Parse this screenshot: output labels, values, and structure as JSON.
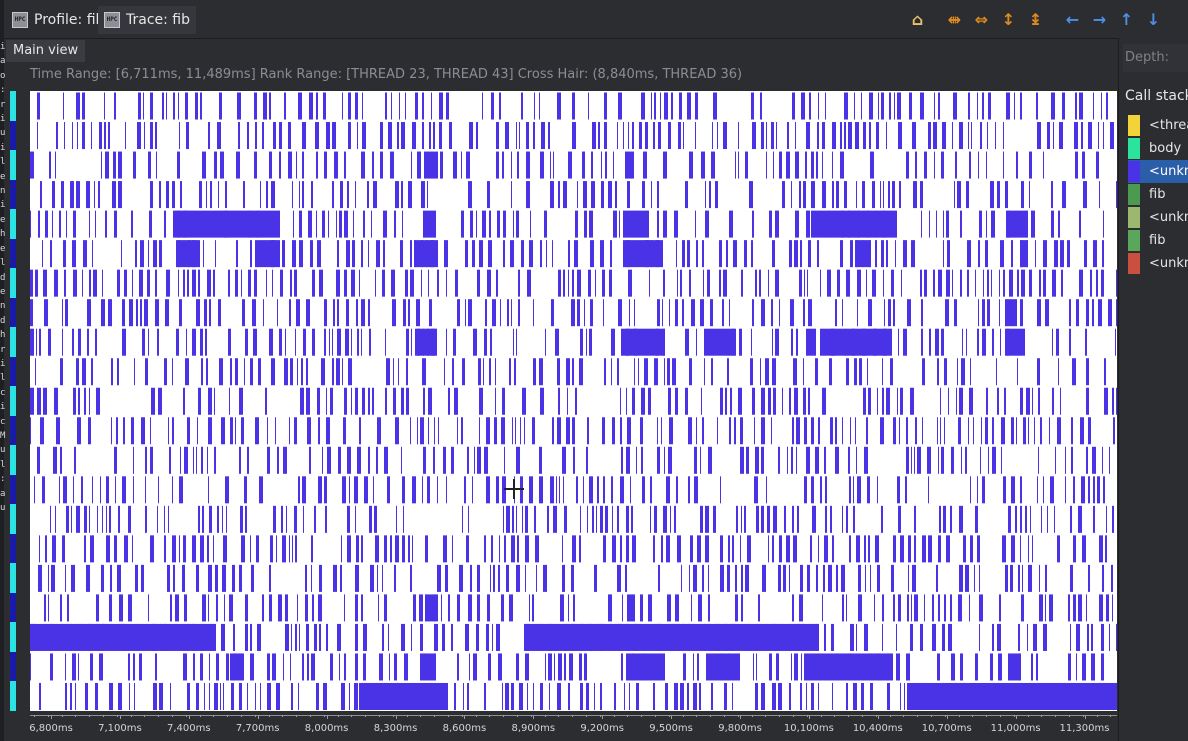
{
  "tabs": [
    {
      "label": "Profile: fib",
      "icon": "hpc-icon"
    },
    {
      "label": "Trace: fib",
      "icon": "hpc-icon"
    }
  ],
  "toolbar": [
    {
      "name": "home-button",
      "icon": "home-icon",
      "glyph": "⌂",
      "color": "#e8c26a"
    },
    {
      "name": "zoom-out-time-button",
      "icon": "zoom-out-time-icon",
      "glyph": "⇼",
      "color": "#e08a1e"
    },
    {
      "name": "zoom-in-time-button",
      "icon": "zoom-in-time-icon",
      "glyph": "⇔",
      "color": "#e08a1e"
    },
    {
      "name": "zoom-in-process-button",
      "icon": "zoom-in-process-icon",
      "glyph": "↕",
      "color": "#e08a1e"
    },
    {
      "name": "zoom-out-process-button",
      "icon": "zoom-out-process-icon",
      "glyph": "↨",
      "color": "#e08a1e"
    },
    {
      "name": "scroll-left-button",
      "icon": "arrow-left-icon",
      "glyph": "←",
      "color": "#4f8fe6"
    },
    {
      "name": "scroll-right-button",
      "icon": "arrow-right-icon",
      "glyph": "→",
      "color": "#4f8fe6"
    },
    {
      "name": "scroll-up-button",
      "icon": "arrow-up-icon",
      "glyph": "↑",
      "color": "#4f8fe6"
    },
    {
      "name": "scroll-down-button",
      "icon": "arrow-down-icon",
      "glyph": "↓",
      "color": "#4f8fe6"
    }
  ],
  "main_view": {
    "tab_label": "Main view",
    "info": "Time Range: [6,711ms, 11,489ms]  Rank Range: [THREAD 23, THREAD 43]  Cross Hair: (8,840ms, THREAD 36)"
  },
  "axis_ticks": [
    "6,800ms",
    "7,100ms",
    "7,400ms",
    "7,700ms",
    "8,000ms",
    "8,300ms",
    "8,600ms",
    "8,900ms",
    "9,200ms",
    "9,500ms",
    "9,800ms",
    "10,100ms",
    "10,400ms",
    "10,700ms",
    "11,000ms",
    "11,300ms"
  ],
  "right_panel": {
    "depth_placeholder": "Depth:",
    "call_stack_title": "Call stack",
    "items": [
      {
        "label": "<threa",
        "color": "#f2d338",
        "selected": false
      },
      {
        "label": "body",
        "color": "#2be39a",
        "selected": false
      },
      {
        "label": "<unkn",
        "color": "#4a33e6",
        "selected": true
      },
      {
        "label": "fib",
        "color": "#4c9a50",
        "selected": false
      },
      {
        "label": "<unkn",
        "color": "#9bb86e",
        "selected": false
      },
      {
        "label": "fib",
        "color": "#5aa65a",
        "selected": false
      },
      {
        "label": "<unkn",
        "color": "#c9503f",
        "selected": false
      }
    ]
  },
  "colors": {
    "trace_fill": "#4a33e6",
    "trace_background": "#ffffff",
    "side_body": "#2be3e3",
    "side_dark": "#1a1aa8"
  },
  "left_letters": "i a o : r i u i l e n i e h e l d e n d h r i l c i c M u l : a u"
}
